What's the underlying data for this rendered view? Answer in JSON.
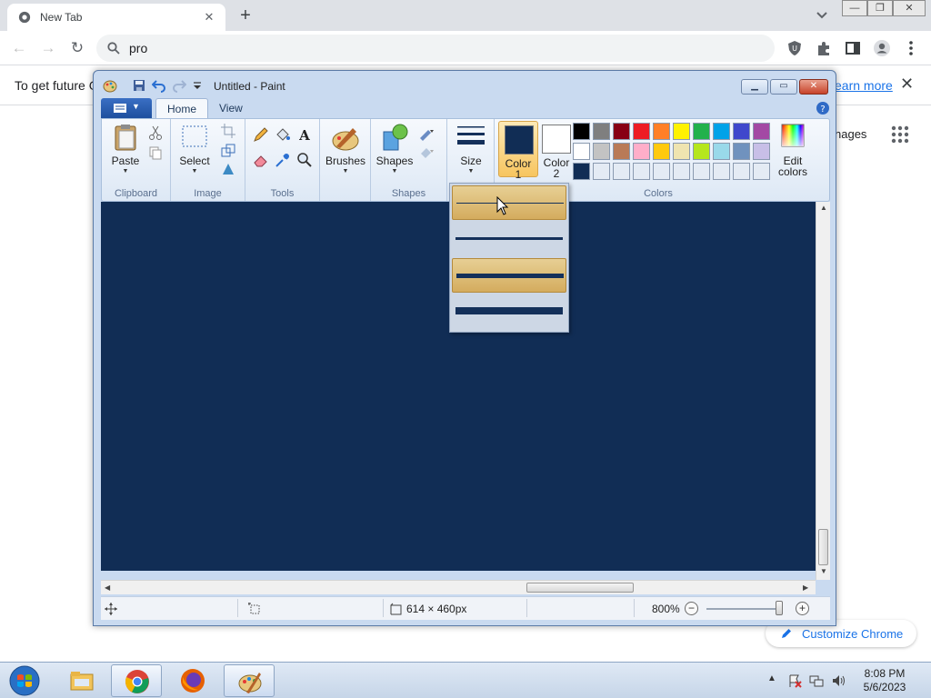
{
  "browser": {
    "tab_title": "New Tab",
    "address_value": "pro",
    "infobar_message": "To get future G",
    "infobar_link": "earn more",
    "images_link": "nages",
    "customize_label": "Customize Chrome"
  },
  "paint": {
    "window_title": "Untitled - Paint",
    "tabs": [
      "Home",
      "View"
    ],
    "groups": {
      "clipboard": "Clipboard",
      "image": "Image",
      "tools": "Tools",
      "shapes": "Shapes",
      "colors": "Colors"
    },
    "buttons": {
      "paste": "Paste",
      "select": "Select",
      "brushes": "Brushes",
      "shapes": "Shapes",
      "size": "Size",
      "color1_line1": "Color",
      "color1_line2": "1",
      "color2_line1": "Color",
      "color2_line2": "2",
      "edit_colors_line1": "Edit",
      "edit_colors_line2": "colors"
    },
    "color1": "#112d55",
    "color2": "#ffffff",
    "palette": [
      [
        "#000000",
        "#7f7f7f",
        "#880015",
        "#ed1c24",
        "#ff7f27",
        "#fff200",
        "#22b14c",
        "#00a2e8",
        "#3f48cc",
        "#a349a4"
      ],
      [
        "#ffffff",
        "#c3c3c3",
        "#b97a57",
        "#ffaec9",
        "#ffc90e",
        "#efe4b0",
        "#b5e61d",
        "#99d9ea",
        "#7092be",
        "#c8bfe7"
      ],
      [
        "#112d55",
        "#e4ebf4",
        "#e4ebf4",
        "#e4ebf4",
        "#e4ebf4",
        "#e4ebf4",
        "#e4ebf4",
        "#e4ebf4",
        "#e4ebf4",
        "#e4ebf4"
      ]
    ],
    "size_options": [
      {
        "name": "size-1px",
        "selected": true
      },
      {
        "name": "size-3px",
        "selected": false
      },
      {
        "name": "size-5px",
        "selected": true
      },
      {
        "name": "size-8px",
        "selected": false
      }
    ],
    "status": {
      "dimensions": "614 × 460px",
      "zoom": "800%"
    }
  },
  "taskbar": {
    "time": "8:08 PM",
    "date": "5/6/2023"
  }
}
